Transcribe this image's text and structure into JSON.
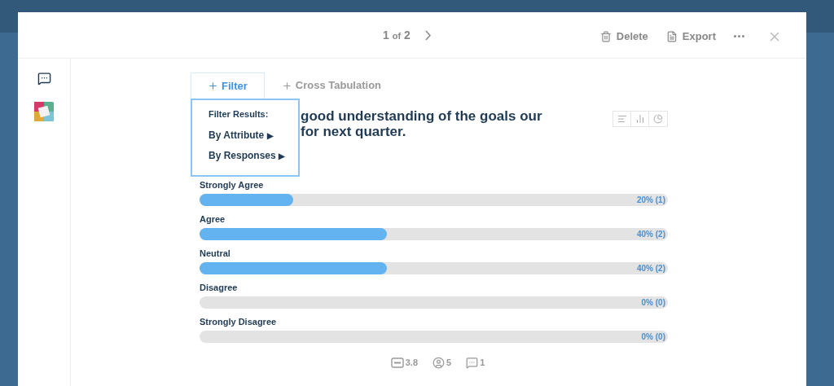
{
  "pager": {
    "current": "1",
    "of": "of",
    "total": "2"
  },
  "actions": [
    {
      "kind": "delete",
      "label": "Delete"
    },
    {
      "kind": "export",
      "label": "Export"
    }
  ],
  "tabs": [
    {
      "label": "Filter",
      "selected": true
    },
    {
      "label": "Cross Tabulation",
      "selected": false
    }
  ],
  "filter_menu": {
    "heading": "Filter Results:",
    "items": [
      {
        "label": "By Attribute",
        "arrow": "▶"
      },
      {
        "label": "By Responses",
        "arrow": "▶"
      }
    ]
  },
  "question": {
    "lines": [
      "good understanding of the goals our",
      "for next quarter."
    ]
  },
  "results": [
    {
      "label": "Strongly Agree",
      "level": 0.2,
      "reading": "20% (1)"
    },
    {
      "label": "Agree",
      "level": 0.4,
      "reading": "40% (2)"
    },
    {
      "label": "Neutral",
      "level": 0.4,
      "reading": "40% (2)"
    },
    {
      "label": "Disagree",
      "level": 0,
      "reading": "0% (0)"
    },
    {
      "label": "Strongly Disagree",
      "level": 0,
      "reading": "0% (0)"
    }
  ],
  "stats": [
    {
      "kind": "average",
      "value": "3.8"
    },
    {
      "kind": "respondents",
      "value": "5"
    },
    {
      "kind": "comments",
      "value": "1"
    }
  ]
}
